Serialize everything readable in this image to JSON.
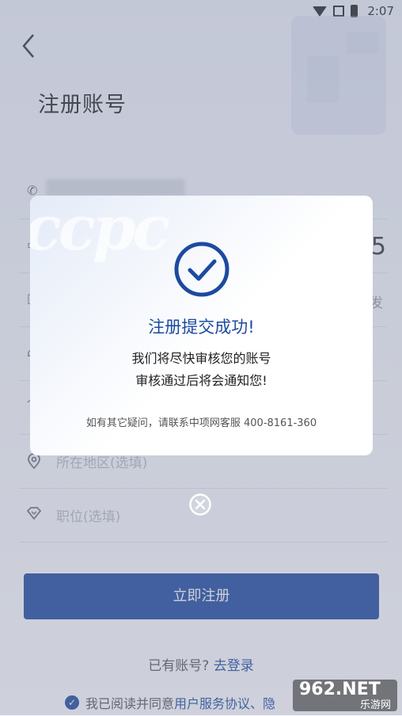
{
  "status_bar": {
    "time": "2:07"
  },
  "page": {
    "title": "注册账号",
    "phone_masked": "",
    "code_digit": "5",
    "send_fragment": "发"
  },
  "form": {
    "region_placeholder": "所在地区(选填)",
    "position_placeholder": "职位(选填)"
  },
  "register_button": "立即注册",
  "login_prompt": {
    "text": "已有账号?",
    "link": "去登录"
  },
  "agreement": {
    "text": "我已阅读并同意",
    "link1": "用户服务协议、",
    "link2": "隐"
  },
  "watermark": {
    "main": "962.NET",
    "sub": "乐游网"
  },
  "modal": {
    "logo": "ccpc",
    "title": "注册提交成功!",
    "message_line1": "我们将尽快审核您的账号",
    "message_line2": "审核通过后将会通知您!",
    "contact": "如有其它疑问，请联系中项网客服 400-8161-360"
  },
  "colors": {
    "primary": "#1d4a9f",
    "overlay": "rgba(125,135,160,0.38)"
  },
  "icons": [
    "back-arrow-icon",
    "phone-icon",
    "location-icon",
    "diamond-icon",
    "check-circle-icon",
    "close-circle-icon"
  ]
}
